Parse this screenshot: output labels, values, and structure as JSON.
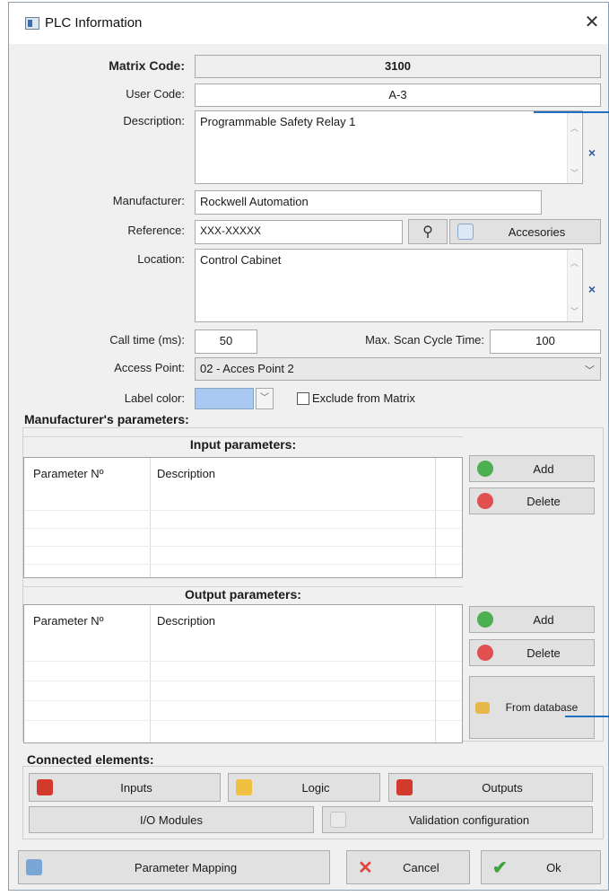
{
  "window": {
    "title": "PLC Information",
    "close_glyph": "✕"
  },
  "form": {
    "matrix_code_label": "Matrix Code:",
    "matrix_code_value": "3100",
    "user_code_label": "User Code:",
    "user_code_value": "A-3",
    "description_label": "Description:",
    "description_value": "Programmable Safety Relay 1",
    "manufacturer_label": "Manufacturer:",
    "manufacturer_value": "Rockwell Automation",
    "reference_label": "Reference:",
    "reference_value": "XXX-XXXXX",
    "accessories_label": "Accesories",
    "location_label": "Location:",
    "location_value": "Control Cabinet",
    "call_time_label": "Call time (ms):",
    "call_time_value": "50",
    "max_scan_label": "Max. Scan Cycle Time:",
    "max_scan_value": "100",
    "access_point_label": "Access Point:",
    "access_point_value": "02 - Acces Point 2",
    "label_color_label": "Label color:",
    "label_color_swatch": "#a9c9f2",
    "exclude_label": "Exclude from Matrix",
    "clear_glyph": "×"
  },
  "manufacturer_params": {
    "section_label": "Manufacturer's parameters:",
    "input": {
      "title": "Input parameters:",
      "col_param": "Parameter Nº",
      "col_desc": "Description",
      "add_label": "Add",
      "delete_label": "Delete"
    },
    "output": {
      "title": "Output parameters:",
      "col_param": "Parameter Nº",
      "col_desc": "Description",
      "add_label": "Add",
      "delete_label": "Delete",
      "from_db_label": "From database"
    }
  },
  "connected": {
    "section_label": "Connected elements:",
    "inputs_label": "Inputs",
    "logic_label": "Logic",
    "outputs_label": "Outputs",
    "io_modules_label": "I/O Modules",
    "validation_label": "Validation configuration"
  },
  "footer": {
    "parameter_mapping_label": "Parameter Mapping",
    "cancel_label": "Cancel",
    "ok_label": "Ok"
  },
  "colors": {
    "add_icon": "#4caf50",
    "delete_icon": "#e05050",
    "warning_icon": "#d33a2c",
    "accent_blue": "#1f6fbf"
  }
}
